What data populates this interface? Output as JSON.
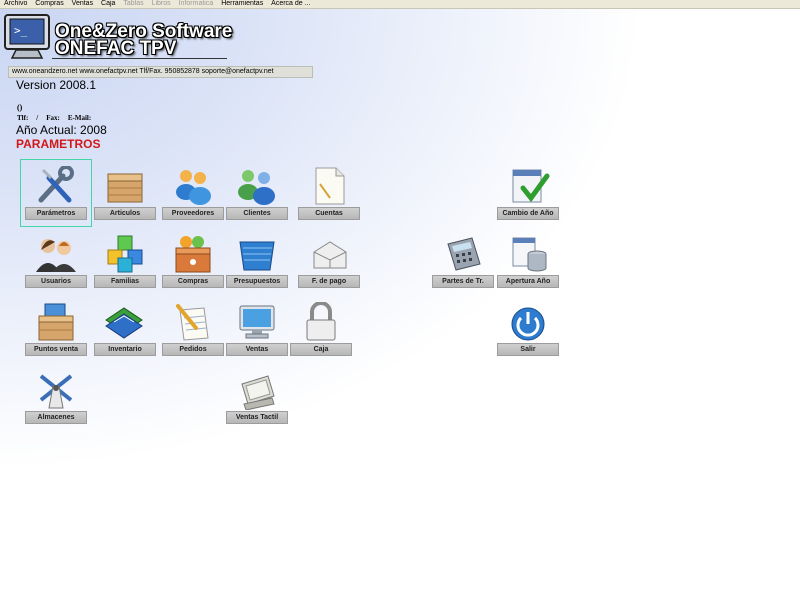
{
  "menu": [
    {
      "label": "Archivo",
      "enabled": true
    },
    {
      "label": "Compras",
      "enabled": true
    },
    {
      "label": "Ventas",
      "enabled": true
    },
    {
      "label": "Caja",
      "enabled": true
    },
    {
      "label": "Tablas",
      "enabled": false
    },
    {
      "label": "Libros",
      "enabled": false
    },
    {
      "label": "Informatica",
      "enabled": false
    },
    {
      "label": "Herramientas",
      "enabled": true
    },
    {
      "label": "Acerca de ...",
      "enabled": true
    }
  ],
  "brand": {
    "line1": "One&Zero Software",
    "line2": "ONEFAC TPV"
  },
  "contact": "www.oneandzero.net www.onefactpv.net Tlf/Fax. 950852878 soporte@onefactpv.net",
  "version": "Version 2008.1",
  "company_name": "()",
  "fields": {
    "tlf": "Tlf:",
    "slash": "/",
    "fax": "Fax:",
    "email": "E-Mail:"
  },
  "year": "Año Actual: 2008",
  "section_title": "PARAMETROS",
  "tiles": {
    "parametros": "Parámetros",
    "articulos": "Articulos",
    "proveedores": "Proveedores",
    "clientes": "Clientes",
    "cuentas": "Cuentas",
    "cambio_ano": "Cambio de Año",
    "usuarios": "Usuarios",
    "familias": "Familias",
    "compras": "Compras",
    "presupuestos": "Presupuestos",
    "f_pago": "F. de pago",
    "partes": "Partes de Tr.",
    "apertura": "Apertura Año",
    "puntos_venta": "Puntos venta",
    "inventario": "Inventario",
    "pedidos": "Pedidos",
    "ventas": "Ventas",
    "caja": "Caja",
    "salir": "Salir",
    "almacenes": "Almacenes",
    "ventas_tactil": "Ventas Tactil"
  },
  "icons": {
    "parametros": "wrench-screwdriver-icon",
    "articulos": "box-icon",
    "proveedores": "people-group-icon",
    "clientes": "people-group-icon",
    "cuentas": "document-icon",
    "cambio_ano": "calendar-check-icon",
    "usuarios": "users-icon",
    "familias": "cubes-icon",
    "compras": "basket-box-icon",
    "presupuestos": "stack-notepad-icon",
    "f_pago": "paper-tray-icon",
    "partes": "calculator-icon",
    "apertura": "database-icon",
    "puntos_venta": "store-box-icon",
    "inventario": "books-icon",
    "pedidos": "notepad-pencil-icon",
    "ventas": "monitor-icon",
    "caja": "padlock-icon",
    "salir": "power-icon",
    "almacenes": "windmill-icon",
    "ventas_tactil": "touch-terminal-icon"
  },
  "colors": {
    "title_red": "#d21818",
    "selection": "#44d6a6"
  }
}
